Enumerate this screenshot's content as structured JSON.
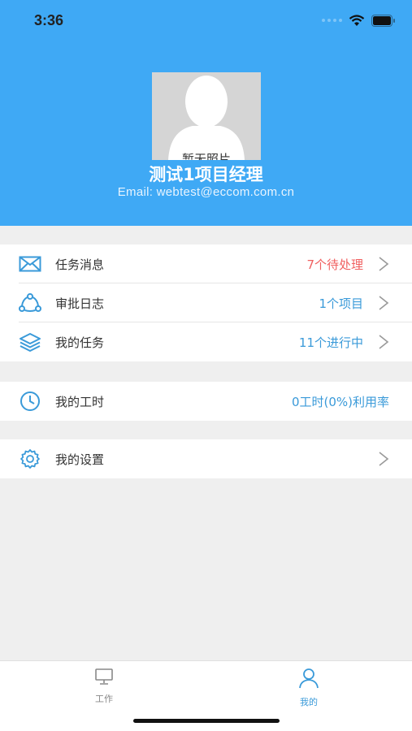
{
  "status_bar": {
    "time": "3:36"
  },
  "profile": {
    "avatar_caption": "暂无照片",
    "name": "测试1项目经理",
    "email": "Email: webtest@eccom.com.cn"
  },
  "menu": {
    "tasks_message": {
      "label": "任务消息",
      "value": "7个待处理",
      "icon": "mail-icon"
    },
    "approval_log": {
      "label": "审批日志",
      "value": "1个项目",
      "icon": "share-nodes-icon"
    },
    "my_tasks": {
      "label": "我的任务",
      "value": "11个进行中",
      "icon": "layers-icon"
    },
    "my_hours": {
      "label": "我的工时",
      "value": "0工时(0%)利用率",
      "icon": "clock-icon"
    },
    "my_settings": {
      "label": "我的设置",
      "icon": "gear-icon"
    }
  },
  "tabbar": {
    "work": {
      "label": "工作",
      "icon": "monitor-icon"
    },
    "mine": {
      "label": "我的",
      "icon": "person-icon"
    }
  },
  "colors": {
    "header_bg": "#3fa9f5",
    "accent_blue": "#3a9ad9",
    "alert_red": "#f06060"
  }
}
